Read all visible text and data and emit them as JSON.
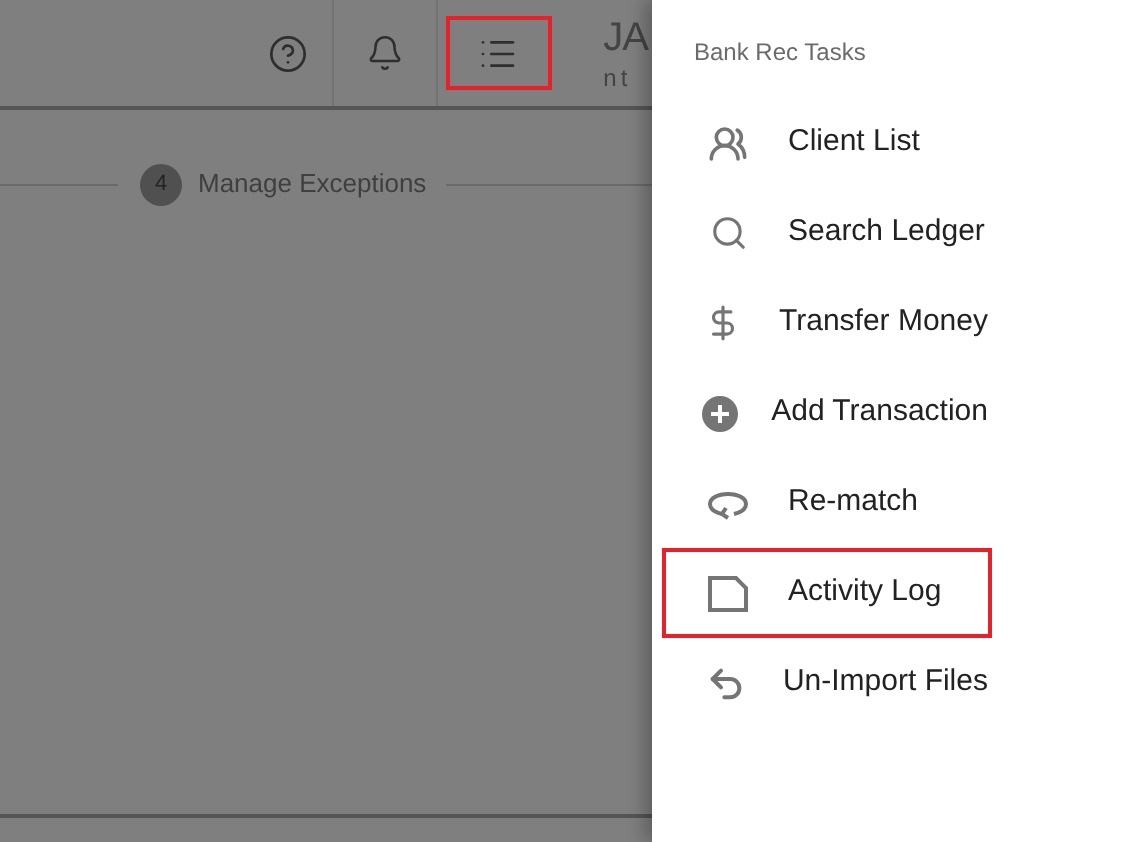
{
  "header": {
    "buttons": [
      {
        "kind": "help",
        "highlighted": false
      },
      {
        "kind": "notifications",
        "highlighted": false
      },
      {
        "kind": "tasks",
        "highlighted": true
      }
    ],
    "user": {
      "name": "JA",
      "subtitle": "nt"
    }
  },
  "stepper": {
    "step": {
      "number": "4",
      "label": "Manage Exceptions"
    }
  },
  "drawer": {
    "title": "Bank Rec Tasks",
    "items": [
      {
        "kind": "clients",
        "label": "Client List",
        "highlighted": false
      },
      {
        "kind": "search",
        "label": "Search Ledger",
        "highlighted": false
      },
      {
        "kind": "money",
        "label": "Transfer Money",
        "highlighted": false
      },
      {
        "kind": "add",
        "label": "Add Transaction",
        "highlighted": false
      },
      {
        "kind": "rematch",
        "label": "Re-match",
        "highlighted": false
      },
      {
        "kind": "log",
        "label": "Activity Log",
        "highlighted": true
      },
      {
        "kind": "undo",
        "label": "Un-Import Files",
        "highlighted": false
      }
    ]
  }
}
